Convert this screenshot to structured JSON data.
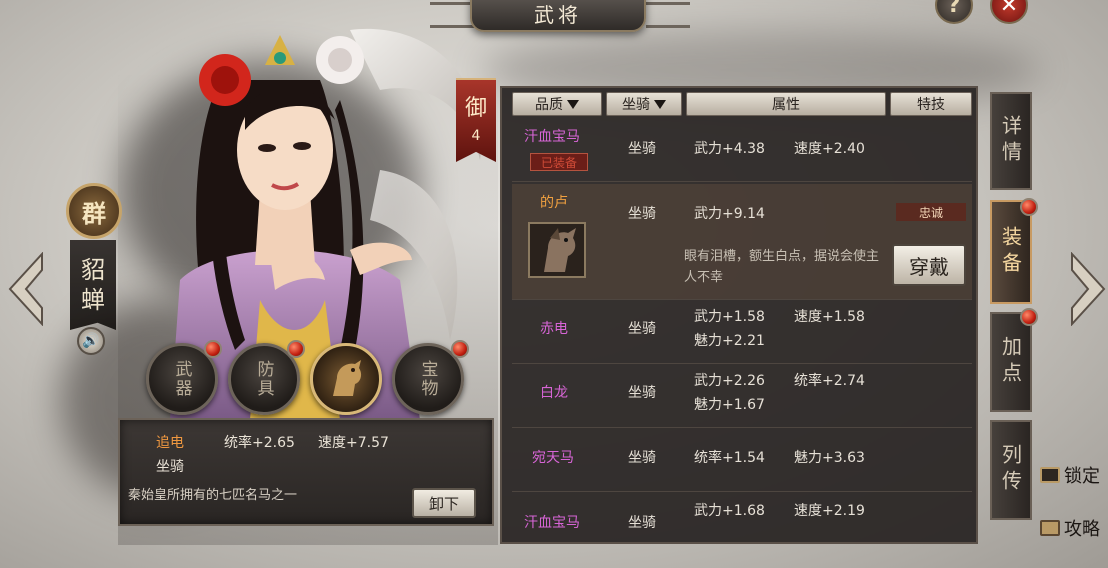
{
  "title": "武将",
  "general": {
    "faction": "群",
    "name_chars": [
      "貂",
      "蝉"
    ]
  },
  "slots": [
    {
      "label": "武器",
      "alert": true
    },
    {
      "label": "防具",
      "alert": true
    },
    {
      "label": "",
      "alert": false,
      "active": true,
      "icon": "horse-icon"
    },
    {
      "label": "宝物",
      "alert": true
    }
  ],
  "equipped": {
    "name": "追电",
    "stat1": "统率+2.65",
    "stat2": "速度+7.57",
    "type": "坐骑",
    "desc": "秦始皇所拥有的七匹名马之一",
    "unequip_label": "卸下"
  },
  "tier": {
    "char": "御",
    "num": "4"
  },
  "table": {
    "headers": {
      "quality": "品质",
      "mount": "坐骑",
      "attr": "属性",
      "skill": "特技"
    },
    "rows": [
      {
        "name": "汗血宝马",
        "badge": "已装备",
        "type": "坐骑",
        "a1": "武力+4.38",
        "a2": "速度+2.40",
        "a3": "",
        "a4": ""
      },
      {
        "name": "的卢",
        "type": "坐骑",
        "a1": "武力+9.14",
        "a2": "",
        "skill": "忠诚",
        "desc": "眼有泪槽，额生白点，据说会使主人不幸",
        "action": "穿戴"
      },
      {
        "name": "赤电",
        "type": "坐骑",
        "a1": "武力+1.58",
        "a2": "速度+1.58",
        "a3": "魅力+2.21",
        "a4": ""
      },
      {
        "name": "白龙",
        "type": "坐骑",
        "a1": "武力+2.26",
        "a2": "统率+2.74",
        "a3": "魅力+1.67",
        "a4": ""
      },
      {
        "name": "宛天马",
        "type": "坐骑",
        "a1": "统率+1.54",
        "a2": "魅力+3.63",
        "a3": "",
        "a4": ""
      },
      {
        "name": "汗血宝马",
        "type": "坐骑",
        "a1": "武力+1.68",
        "a2": "速度+2.19",
        "a3": "",
        "a4": ""
      }
    ]
  },
  "tabs": [
    {
      "label": "详情",
      "alert": false,
      "active": false
    },
    {
      "label": "装备",
      "alert": true,
      "active": true
    },
    {
      "label": "加点",
      "alert": true,
      "active": false
    },
    {
      "label": "列传",
      "alert": false,
      "active": false
    }
  ],
  "side_links": [
    {
      "label": "锁定"
    },
    {
      "label": "攻略"
    }
  ],
  "colors": {
    "accent_red": "#c21f10",
    "purple_name": "#d765d6",
    "orange_name": "#f09840"
  }
}
